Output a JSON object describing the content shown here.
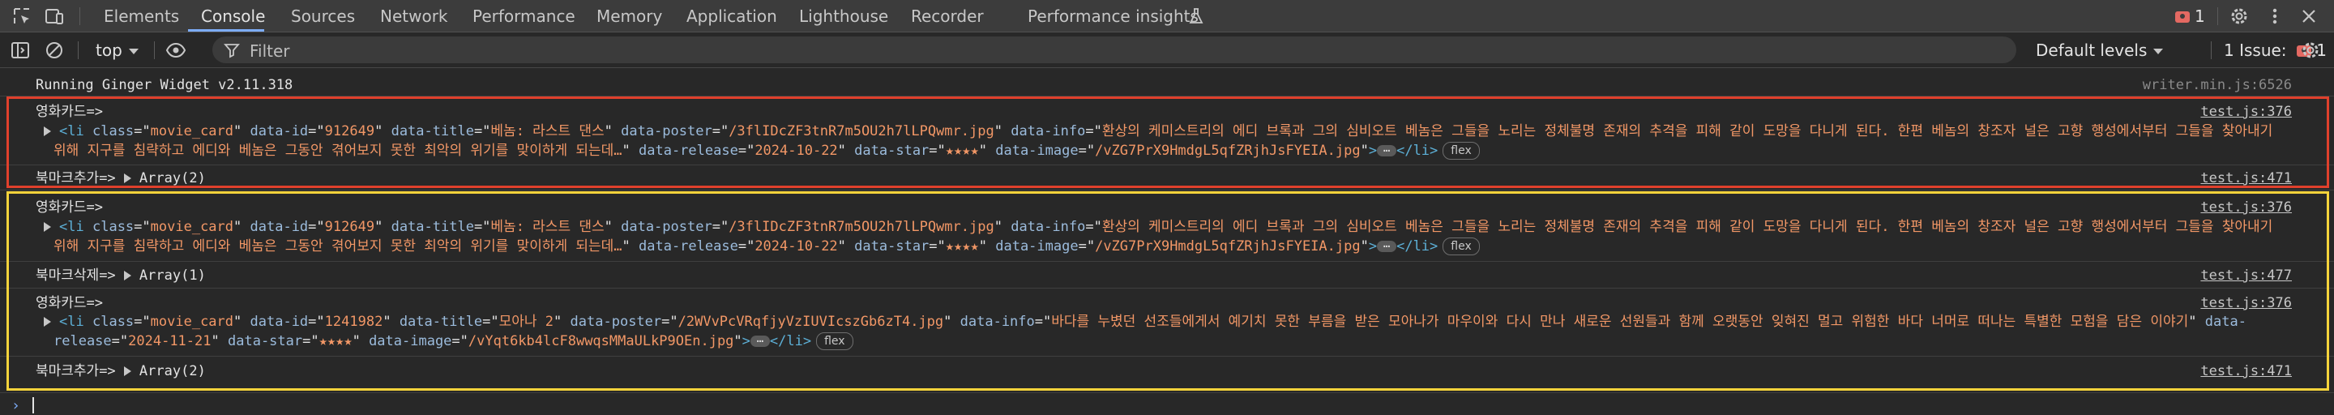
{
  "tabs": [
    {
      "label": "Elements",
      "active": false
    },
    {
      "label": "Console",
      "active": true
    },
    {
      "label": "Sources",
      "active": false
    },
    {
      "label": "Network",
      "active": false
    },
    {
      "label": "Performance",
      "active": false
    },
    {
      "label": "Memory",
      "active": false
    },
    {
      "label": "Application",
      "active": false
    },
    {
      "label": "Lighthouse",
      "active": false
    },
    {
      "label": "Recorder",
      "active": false
    },
    {
      "label": "Performance insights",
      "active": false
    }
  ],
  "topbar": {
    "issues_count": "1",
    "icons": [
      "inspect-icon",
      "device-toolbar-icon",
      "flask-icon",
      "gear-icon",
      "more-icon",
      "close-icon"
    ]
  },
  "toolbar": {
    "context": "top",
    "filter_placeholder": "Filter",
    "levels": "Default levels",
    "issues_label": "1 Issue:",
    "issues_count": "1",
    "icons": [
      "sidebar-icon",
      "clear-icon",
      "eye-icon",
      "filter-icon",
      "settings-icon"
    ]
  },
  "colors": {
    "highlight_red": "#e0402c",
    "highlight_yellow": "#f5d33b",
    "tag": "#5db0d7",
    "attr": "#9bbbdc",
    "value": "#f29766"
  },
  "messages": [
    {
      "kind": "log",
      "text": "Running Ginger Widget v2.11.318",
      "source": "writer.min.js:6526"
    },
    {
      "kind": "element",
      "label": "영화카드=>",
      "source": "test.js:376",
      "tag": "li",
      "close_tag": "</li>",
      "badge": "flex",
      "attrs": [
        {
          "name": "class",
          "value": "movie_card"
        },
        {
          "name": "data-id",
          "value": "912649"
        },
        {
          "name": "data-title",
          "value": "베놈: 라스트 댄스"
        },
        {
          "name": "data-poster",
          "value": "/3flIDcZF3tnR7m5OU2h7lLPQwmr.jpg"
        },
        {
          "name": "data-info",
          "value": "환상의 케미스트리의 에디 브록과 그의 심비오트 베놈은 그들을 노리는 정체불명 존재의 추격을 피해 같이 도망을 다니게 된다. 한편 베놈의 창조자 널은 고향 행성에서부터 그들을 찾아내기 위해 지구를 침략하고 에디와 베놈은 그동안 겪어보지 못한 최악의 위기를 맞이하게 되는데…"
        },
        {
          "name": "data-release",
          "value": "2024-10-22"
        },
        {
          "name": "data-star",
          "value": "★★★★"
        },
        {
          "name": "data-image",
          "value": "/vZG7PrX9HmdgL5qfZRjhJsFYEIA.jpg"
        }
      ]
    },
    {
      "kind": "array",
      "label": "북마크추가=>",
      "array": "Array(2)",
      "source": "test.js:471"
    },
    {
      "kind": "element",
      "label": "영화카드=>",
      "source": "test.js:376",
      "tag": "li",
      "close_tag": "</li>",
      "badge": "flex",
      "attrs": [
        {
          "name": "class",
          "value": "movie_card"
        },
        {
          "name": "data-id",
          "value": "912649"
        },
        {
          "name": "data-title",
          "value": "베놈: 라스트 댄스"
        },
        {
          "name": "data-poster",
          "value": "/3flIDcZF3tnR7m5OU2h7lLPQwmr.jpg"
        },
        {
          "name": "data-info",
          "value": "환상의 케미스트리의 에디 브록과 그의 심비오트 베놈은 그들을 노리는 정체불명 존재의 추격을 피해 같이 도망을 다니게 된다. 한편 베놈의 창조자 널은 고향 행성에서부터 그들을 찾아내기 위해 지구를 침략하고 에디와 베놈은 그동안 겪어보지 못한 최악의 위기를 맞이하게 되는데…"
        },
        {
          "name": "data-release",
          "value": "2024-10-22"
        },
        {
          "name": "data-star",
          "value": "★★★★"
        },
        {
          "name": "data-image",
          "value": "/vZG7PrX9HmdgL5qfZRjhJsFYEIA.jpg"
        }
      ]
    },
    {
      "kind": "array",
      "label": "북마크삭제=>",
      "array": "Array(1)",
      "source": "test.js:477"
    },
    {
      "kind": "element",
      "label": "영화카드=>",
      "source": "test.js:376",
      "tag": "li",
      "close_tag": "</li>",
      "badge": "flex",
      "attrs": [
        {
          "name": "class",
          "value": "movie_card"
        },
        {
          "name": "data-id",
          "value": "1241982"
        },
        {
          "name": "data-title",
          "value": "모아나 2"
        },
        {
          "name": "data-poster",
          "value": "/2WVvPcVRqfjyVzIUVIcszGb6zT4.jpg"
        },
        {
          "name": "data-info",
          "value": "바다를 누볐던 선조들에게서 예기치 못한 부름을 받은 모아나가 마우이와 다시 만나 새로운 선원들과 함께 오랫동안 잊혀진 멀고 위험한 바다 너머로 떠나는 특별한 모험을 담은 이야기"
        },
        {
          "name": "data-release",
          "value": "2024-11-21"
        },
        {
          "name": "data-star",
          "value": "★★★★"
        },
        {
          "name": "data-image",
          "value": "/vYqt6kb4lcF8wwqsMMaULkP9OEn.jpg"
        }
      ]
    },
    {
      "kind": "array",
      "label": "북마크추가=>",
      "array": "Array(2)",
      "source": "test.js:471"
    }
  ]
}
